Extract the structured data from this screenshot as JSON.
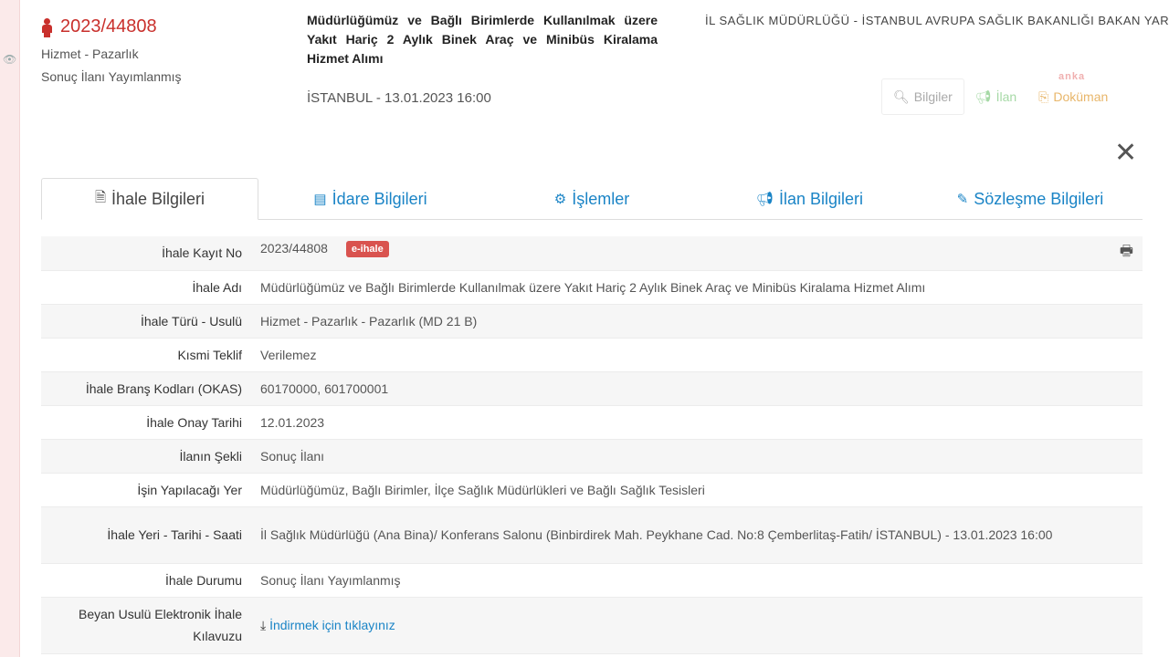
{
  "header": {
    "tender_no": "2023/44808",
    "type": "Hizmet - Pazarlık",
    "status": "Sonuç İlanı Yayımlanmış",
    "title": "Müdürlüğümüz ve Bağlı Birimlerde Kullanılmak üzere Yakıt Hariç 2 Aylık Binek Araç ve Minibüs Kiralama Hizmet Alımı",
    "city_date": "İSTANBUL - 13.01.2023 16:00",
    "agency": "İL SAĞLIK MÜDÜRLÜĞÜ - İSTANBUL AVRUPA SAĞLIK BAKANLIĞI BAKAN YARDIMCILIKLARI"
  },
  "actions": {
    "bilgiler": "Bilgiler",
    "ilan": "İlan",
    "dokuman": "Doküman",
    "badge": "anka"
  },
  "tabs": [
    {
      "label": "İhale Bilgileri",
      "icon": "file-icon"
    },
    {
      "label": "İdare Bilgileri",
      "icon": "building-icon"
    },
    {
      "label": "İşlemler",
      "icon": "cogs-icon"
    },
    {
      "label": "İlan Bilgileri",
      "icon": "bullhorn-icon"
    },
    {
      "label": "Sözleşme Bilgileri",
      "icon": "edit-icon"
    }
  ],
  "table": {
    "rows": [
      {
        "label": "İhale Kayıt No",
        "value": "2023/44808",
        "badge": "e-ihale"
      },
      {
        "label": "İhale Adı",
        "value": "Müdürlüğümüz ve Bağlı Birimlerde Kullanılmak üzere Yakıt Hariç 2 Aylık Binek Araç ve Minibüs Kiralama Hizmet Alımı"
      },
      {
        "label": "İhale Türü - Usulü",
        "value": "Hizmet - Pazarlık - Pazarlık (MD 21 B)"
      },
      {
        "label": "Kısmi Teklif",
        "value": "Verilemez"
      },
      {
        "label": "İhale Branş Kodları (OKAS)",
        "value": "60170000, 601700001"
      },
      {
        "label": "İhale Onay Tarihi",
        "value": "12.01.2023"
      },
      {
        "label": "İlanın Şekli",
        "value": "Sonuç İlanı"
      },
      {
        "label": "İşin Yapılacağı Yer",
        "value": "Müdürlüğümüz, Bağlı Birimler, İlçe Sağlık Müdürlükleri ve Bağlı Sağlık Tesisleri"
      },
      {
        "label": "İhale Yeri - Tarihi - Saati",
        "value": "İl Sağlık Müdürlüğü (Ana Bina)/ Konferans Salonu (Binbirdirek Mah. Peykhane Cad. No:8 Çemberlitaş-Fatih/ İSTANBUL) - 13.01.2023 16:00"
      },
      {
        "label": "İhale Durumu",
        "value": "Sonuç İlanı Yayımlanmış"
      },
      {
        "label": "Beyan Usulü Elektronik İhale Kılavuzu",
        "value": "İndirmek için tıklayınız"
      }
    ]
  },
  "colors": {
    "accent": "#c9302c",
    "link": "#1a84c6"
  }
}
